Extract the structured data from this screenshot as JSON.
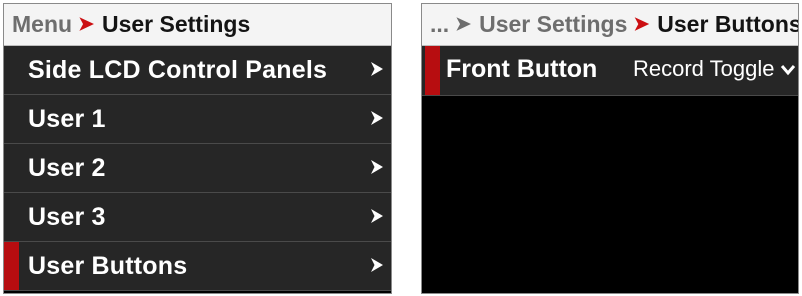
{
  "left_panel": {
    "breadcrumb": {
      "root": "Menu",
      "current": "User Settings"
    },
    "items": [
      {
        "label": "Side LCD Control Panels"
      },
      {
        "label": "User 1"
      },
      {
        "label": "User 2"
      },
      {
        "label": "User 3"
      },
      {
        "label": "User Buttons",
        "selected": true
      }
    ]
  },
  "right_panel": {
    "breadcrumb": {
      "ellipsis": "...",
      "parent": "User Settings",
      "current": "User Buttons"
    },
    "setting": {
      "label": "Front Button",
      "value": "Record Toggle"
    }
  },
  "colors": {
    "accent_red": "#b70d10",
    "row_bg": "#262626",
    "breadcrumb_bg": "#f4f4f4"
  },
  "icons": {
    "breadcrumb_separator": "chevron-right-icon",
    "row_chevron": "chevron-right-icon",
    "dropdown": "chevron-down-icon"
  }
}
